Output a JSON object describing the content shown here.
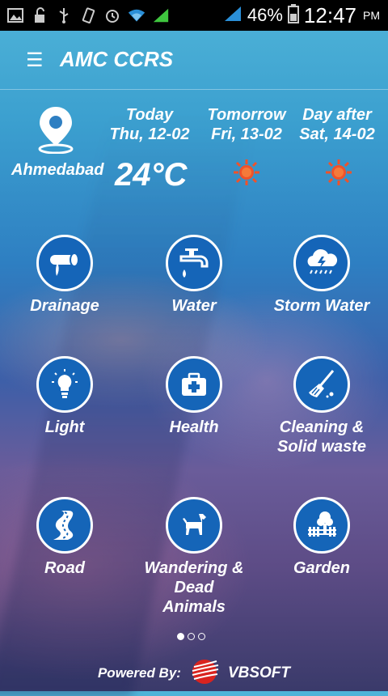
{
  "status_bar": {
    "battery_percent": "46%",
    "time": "12:47",
    "ampm": "PM",
    "icons": [
      "image-icon",
      "unlock-icon",
      "usb-icon",
      "vibrate-icon",
      "alarm-icon",
      "wifi-icon",
      "signal-icon",
      "signal-icon-2",
      "battery-icon"
    ]
  },
  "header": {
    "title": "AMC CCRS",
    "menu_icon": "menu-icon"
  },
  "weather": {
    "city": "Ahmedabad",
    "temperature": "24°C",
    "days": [
      {
        "label": "Today",
        "date": "Thu, 12-02"
      },
      {
        "label": "Tomorrow",
        "date": "Fri, 13-02",
        "icon": "sun-icon"
      },
      {
        "label": "Day after",
        "date": "Sat, 14-02",
        "icon": "sun-icon"
      }
    ]
  },
  "categories": [
    {
      "label": "Drainage",
      "icon": "drainage-icon"
    },
    {
      "label": "Water",
      "icon": "tap-icon"
    },
    {
      "label": "Storm Water",
      "icon": "storm-cloud-icon"
    },
    {
      "label": "Light",
      "icon": "bulb-icon"
    },
    {
      "label": "Health",
      "icon": "first-aid-icon"
    },
    {
      "label": "Cleaning &",
      "label2": "Solid waste",
      "icon": "broom-icon"
    },
    {
      "label": "Road",
      "icon": "road-icon"
    },
    {
      "label": "Wandering &",
      "label2": "Dead",
      "label3": "Animals",
      "icon": "dog-icon"
    },
    {
      "label": "Garden",
      "icon": "tree-icon"
    }
  ],
  "pager": {
    "total": 3,
    "active": 0
  },
  "footer": {
    "powered_by": "Powered By:",
    "brand": "VBSOFT"
  },
  "colors": {
    "accent": "#1565b8",
    "sun": "#f0522a",
    "brand_red": "#d9231f"
  }
}
